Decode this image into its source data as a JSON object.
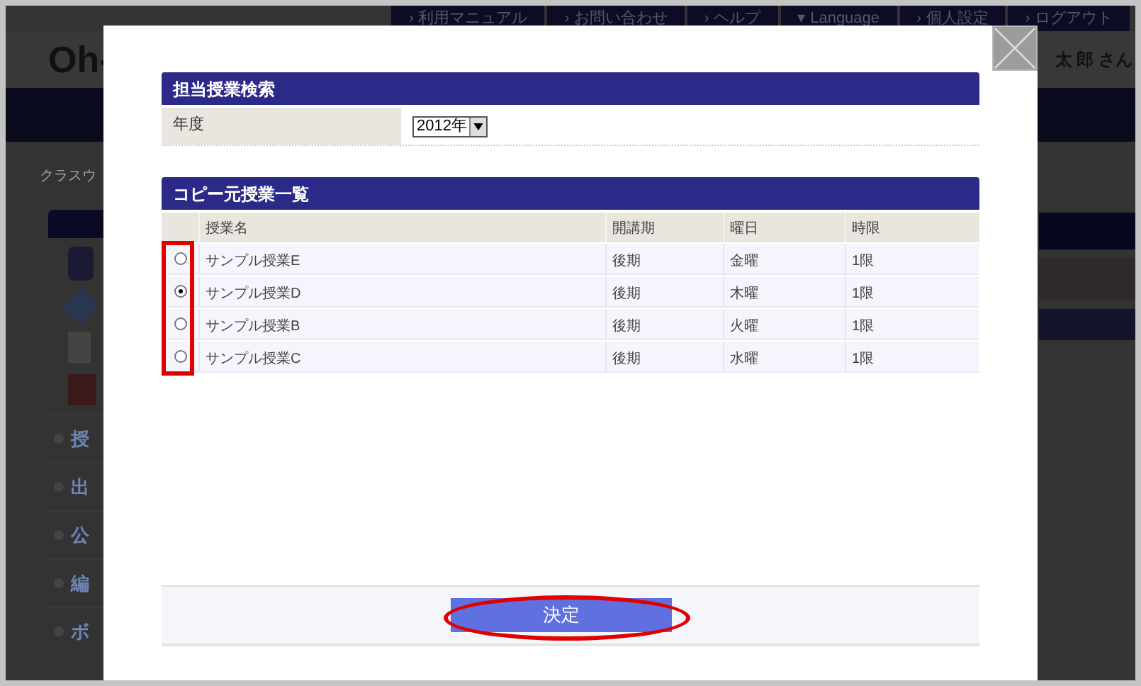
{
  "header_links": [
    "› 利用マニュアル",
    "› お問い合わせ",
    "› ヘルプ",
    "▾ Language",
    "› 個人設定",
    "› ログアウト"
  ],
  "logo": "Oh-",
  "user_name": "太 郎 さん",
  "breadcrumb": "クラスウ",
  "sidebar_items": [
    "授",
    "出",
    "公",
    "編",
    "ボ"
  ],
  "search_section": {
    "title": "担当授業検索",
    "fields": [
      {
        "label": "年度",
        "value": "2012年"
      }
    ]
  },
  "list_section": {
    "title": "コピー元授業一覧",
    "columns": [
      "授業名",
      "開講期",
      "曜日",
      "時限"
    ],
    "rows": [
      {
        "selected": false,
        "cells": [
          "サンプル授業E",
          "後期",
          "金曜",
          "1限"
        ]
      },
      {
        "selected": true,
        "cells": [
          "サンプル授業D",
          "後期",
          "木曜",
          "1限"
        ]
      },
      {
        "selected": false,
        "cells": [
          "サンプル授業B",
          "後期",
          "火曜",
          "1限"
        ]
      },
      {
        "selected": false,
        "cells": [
          "サンプル授業C",
          "後期",
          "水曜",
          "1限"
        ]
      }
    ]
  },
  "submit_button": "決定"
}
